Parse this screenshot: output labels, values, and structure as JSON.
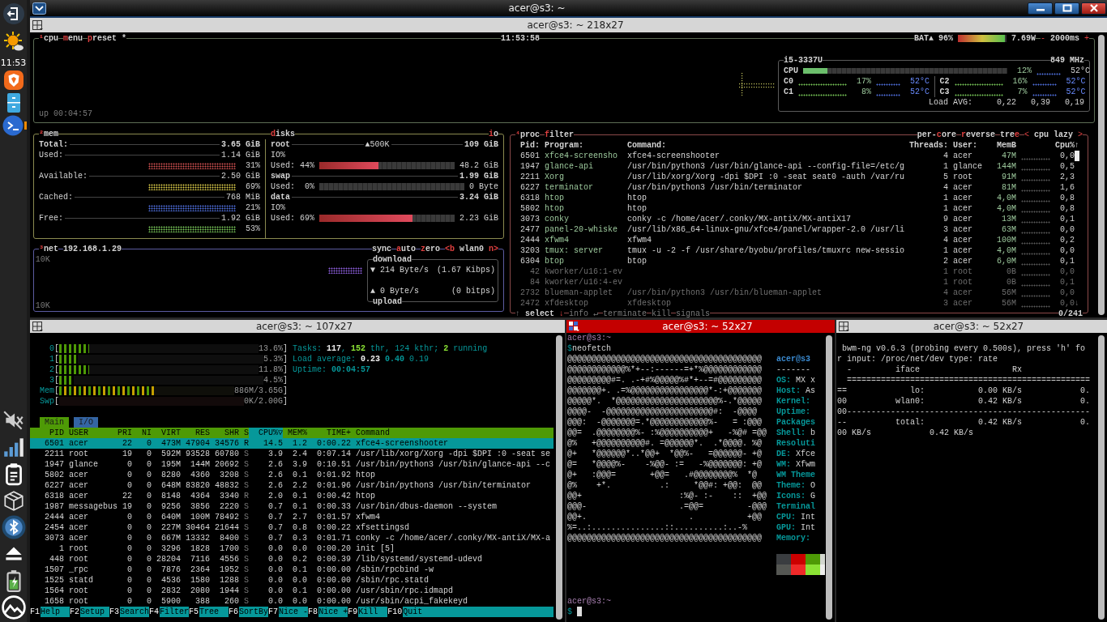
{
  "dock": {
    "clock": "11:53"
  },
  "window": {
    "title": "acer@s3: ~"
  },
  "btop_pane": {
    "title": "acer@s3: ~ 218x27",
    "active": false,
    "cpu_box": {
      "tabs": [
        {
          "parts": [
            {
              "text": "¹",
              "hotkey": true
            },
            {
              "text": "cpu",
              "hotkey": false
            }
          ]
        },
        {
          "parts": [
            {
              "text": "m",
              "hotkey": true
            },
            {
              "text": "enu",
              "hotkey": false
            }
          ]
        },
        {
          "parts": [
            {
              "text": "p",
              "hotkey": true
            },
            {
              "text": "reset *",
              "hotkey": false
            }
          ]
        }
      ],
      "clock": "11:53:58",
      "battery": {
        "label": "BAT▲",
        "percent": "96%",
        "level": 0.96,
        "power": "7.69W"
      },
      "interval": {
        "minus": "-",
        "value": "2000ms",
        "plus": "+"
      },
      "uptime": "up 00:04:57",
      "cpu_panel": {
        "model": "i5-3337U",
        "frequency": "849 MHz",
        "total": {
          "name": "CPU",
          "level": 0.12,
          "percent": "12%",
          "temperature": "52°C"
        },
        "cores": [
          {
            "name": "C0",
            "percent": "17%",
            "temperature": "52°C"
          },
          {
            "name": "C2",
            "percent": "16%",
            "temperature": "52°C"
          },
          {
            "name": "C1",
            "percent": "8%",
            "temperature": "52°C"
          },
          {
            "name": "C3",
            "percent": "7%",
            "temperature": "52°C"
          }
        ],
        "load": {
          "label": "Load AVG:",
          "values": [
            "0,22",
            "0,39",
            "0,19"
          ]
        }
      }
    },
    "mem_box": {
      "title": [
        {
          "text": "²",
          "hotkey": true
        },
        {
          "text": "mem",
          "hotkey": false
        }
      ],
      "rows": [
        {
          "label": "Total:",
          "value": "3.65 GiB",
          "bold": true
        },
        {
          "label": "Used:",
          "value": "1.14 GiB",
          "bold": false,
          "meter": {
            "kind": "used",
            "percent": "31%"
          }
        },
        {
          "label": "Available:",
          "value": "2.50 GiB",
          "bold": false,
          "meter": {
            "kind": "available",
            "percent": "69%"
          }
        },
        {
          "label": "Cached:",
          "value": "768 MiB",
          "bold": false,
          "meter": {
            "kind": "cached",
            "percent": "21%"
          }
        },
        {
          "label": "Free:",
          "value": "1.92 GiB",
          "bold": false,
          "meter": {
            "kind": "free",
            "percent": "53%"
          }
        }
      ]
    },
    "disks_box": {
      "title": [
        {
          "text": "d",
          "hotkey": true
        },
        {
          "text": "isks",
          "hotkey": false
        }
      ],
      "io_toggle": [
        {
          "text": "i",
          "hotkey": true
        },
        {
          "text": "o",
          "hotkey": false
        }
      ],
      "disks": [
        {
          "name": "root",
          "speed": "▲500K",
          "total": "109 GiB",
          "io_label": "IO%",
          "used_label": "Used:",
          "used_percent": "44%",
          "level": 0.44,
          "used": "48.2 GiB"
        },
        {
          "name": "swap",
          "total": "1.99 GiB",
          "used_label": "Used:",
          "used_percent": "0%",
          "level": 0,
          "used": "0 Byte"
        },
        {
          "name": "data",
          "total": "3.24 GiB",
          "io_label": "IO%",
          "used_label": "Used:",
          "used_percent": "69%",
          "level": 0.69,
          "used": "2.23 GiB"
        }
      ]
    },
    "net_box": {
      "title": [
        {
          "text": "³",
          "hotkey": true
        },
        {
          "text": "net",
          "hotkey": false
        }
      ],
      "address": "192.168.1.29",
      "controls": [
        {
          "parts": [
            {
              "text": "sync",
              "hotkey": false
            }
          ]
        },
        {
          "parts": [
            {
              "text": "a",
              "hotkey": true
            },
            {
              "text": "uto",
              "hotkey": false
            }
          ]
        },
        {
          "parts": [
            {
              "text": "z",
              "hotkey": true
            },
            {
              "text": "ero",
              "hotkey": false
            }
          ]
        }
      ],
      "previous": "<b",
      "interface": "wlan0",
      "next": "n>",
      "scale_top": "10K",
      "scale_bottom": "10K",
      "download": {
        "title": "download",
        "arrow": "▼",
        "rate": "214 Byte/s",
        "bits": "(1.67 Kibps)"
      },
      "upload": {
        "title": "upload",
        "arrow": "▲",
        "rate": "0 Byte/s",
        "bits": "(0 bitps)"
      }
    },
    "proc_box": {
      "title": [
        {
          "text": "⁴",
          "hotkey": true
        },
        {
          "text": "proc",
          "hotkey": false
        }
      ],
      "filter": [
        {
          "text": "f",
          "hotkey": true
        },
        {
          "text": "ilter",
          "hotkey": false
        }
      ],
      "options": [
        {
          "parts": [
            {
              "text": "per-",
              "hotkey": false
            },
            {
              "text": "c",
              "hotkey": true
            },
            {
              "text": "ore",
              "hotkey": false
            }
          ]
        },
        {
          "parts": [
            {
              "text": "r",
              "hotkey": true
            },
            {
              "text": "everse",
              "hotkey": false
            }
          ]
        },
        {
          "parts": [
            {
              "text": "tre",
              "hotkey": false
            },
            {
              "text": "e",
              "hotkey": true
            }
          ]
        }
      ],
      "sort": {
        "previous": "<",
        "value": "cpu lazy",
        "next": ">"
      },
      "columns": [
        "Pid:",
        "Program:",
        "Command:",
        "Threads:",
        "User:",
        "MemB",
        "Cpu%"
      ],
      "scroll_up": "↑",
      "scroll_down": "↓",
      "rows": [
        {
          "pid": "6501",
          "program": "xfce4-screensho",
          "command": "xfce4-screenshooter",
          "threads": "4",
          "user": "acer",
          "mem": "47M",
          "cpu": "0,0",
          "dimmed": false
        },
        {
          "pid": "1947",
          "program": "glance-api",
          "command": "/usr/bin/python3 /usr/bin/glance-api --config-file=/etc/g",
          "threads": "1",
          "user": "glance",
          "mem": "144M",
          "cpu": "0,5",
          "dimmed": false
        },
        {
          "pid": "2211",
          "program": "Xorg",
          "command": "/usr/lib/xorg/Xorg -dpi $DPI :0 -seat seat0 -auth /var/ru",
          "threads": "5",
          "user": "root",
          "mem": "91M",
          "cpu": "2,3",
          "dimmed": false
        },
        {
          "pid": "6227",
          "program": "terminator",
          "command": "/usr/bin/python3 /usr/bin/terminator",
          "threads": "4",
          "user": "acer",
          "mem": "81M",
          "cpu": "1,6",
          "dimmed": false
        },
        {
          "pid": "6318",
          "program": "htop",
          "command": "htop",
          "threads": "1",
          "user": "acer",
          "mem": "4,0M",
          "cpu": "0,8",
          "dimmed": false
        },
        {
          "pid": "5802",
          "program": "htop",
          "command": "htop",
          "threads": "1",
          "user": "acer",
          "mem": "4,0M",
          "cpu": "0,8",
          "dimmed": false
        },
        {
          "pid": "3073",
          "program": "conky",
          "command": "conky -c /home/acer/.conky/MX-antiX/MX-antiX17",
          "threads": "9",
          "user": "acer",
          "mem": "13M",
          "cpu": "0,1",
          "dimmed": false
        },
        {
          "pid": "2477",
          "program": "panel-20-whiske",
          "command": "/usr/lib/x86_64-linux-gnu/xfce4/panel/wrapper-2.0 /usr/li",
          "threads": "3",
          "user": "acer",
          "mem": "63M",
          "cpu": "0,0",
          "dimmed": false
        },
        {
          "pid": "2444",
          "program": "xfwm4",
          "command": "xfwm4",
          "threads": "4",
          "user": "acer",
          "mem": "100M",
          "cpu": "0,2",
          "dimmed": false
        },
        {
          "pid": "3203",
          "program": "tmux: server",
          "command": "tmux -u -2 -f /usr/share/byobu/profiles/tmuxrc new-sessio",
          "threads": "1",
          "user": "acer",
          "mem": "4,0M",
          "cpu": "0,0",
          "dimmed": false
        },
        {
          "pid": "6304",
          "program": "btop",
          "command": "btop",
          "threads": "2",
          "user": "acer",
          "mem": "6,0M",
          "cpu": "0,1",
          "dimmed": false
        },
        {
          "pid": "42",
          "program": "kworker/u16:1-ev",
          "threads": "1",
          "user": "root",
          "mem": "0B",
          "cpu": "0,0",
          "dimmed": true
        },
        {
          "pid": "84",
          "program": "kworker/u16:4-ev",
          "threads": "1",
          "user": "root",
          "mem": "0B",
          "cpu": "0,1",
          "dimmed": true
        },
        {
          "pid": "2732",
          "program": "blueman-applet",
          "command": "/usr/bin/python3 /usr/bin/blueman-applet",
          "threads": "4",
          "user": "acer",
          "mem": "56M",
          "cpu": "0,0",
          "dimmed": true
        },
        {
          "pid": "2472",
          "program": "xfdesktop",
          "command": "xfdesktop",
          "threads": "3",
          "user": "acer",
          "mem": "56M",
          "cpu": "0,0",
          "dimmed": true
        }
      ],
      "footer": {
        "select": {
          "up": "↑",
          "label": "select",
          "down": "↓"
        },
        "actions": [
          {
            "label": "info",
            "symbol": "↵",
            "disabled": true
          },
          {
            "label": "terminate",
            "disabled": true
          },
          {
            "label": "kill",
            "disabled": true
          },
          {
            "label": "signals",
            "disabled": true
          }
        ],
        "count": "0/241"
      }
    }
  },
  "htop_pane": {
    "title": "acer@s3: ~ 107x27",
    "active": false,
    "meters": [
      {
        "label": "0",
        "kind": "cpu",
        "open": "[",
        "level": 0.15,
        "reading": "13.6%",
        "close": "]"
      },
      {
        "label": "1",
        "kind": "cpu",
        "open": "[",
        "level": 0.09,
        "reading": "5.3%",
        "close": "]"
      },
      {
        "label": "2",
        "kind": "cpu",
        "open": "[",
        "level": 0.15,
        "reading": "11.8%",
        "close": "]"
      },
      {
        "label": "3",
        "kind": "cpu",
        "open": "[",
        "level": 0.07,
        "reading": "4.5%",
        "close": "]"
      },
      {
        "label": "Mem",
        "kind": "memory",
        "open": "[",
        "level": 0.54,
        "reading": "886M/3.65G",
        "close": "]"
      },
      {
        "label": "Swp",
        "kind": "swap",
        "open": "[",
        "level": 0,
        "reading": "0K/2.00G",
        "close": "]"
      }
    ],
    "info": [
      [
        {
          "text": "Tasks: ",
          "kind": "label"
        },
        {
          "text": "117",
          "kind": "value"
        },
        {
          "text": ", ",
          "kind": "label"
        },
        {
          "text": "152",
          "kind": "accent"
        },
        {
          "text": " thr, ",
          "kind": "label"
        },
        {
          "text": "124",
          "kind": "label"
        },
        {
          "text": " kthr; ",
          "kind": "label"
        },
        {
          "text": "2",
          "kind": "accent"
        },
        {
          "text": " running",
          "kind": "label"
        }
      ],
      [
        {
          "text": "Load average: ",
          "kind": "label"
        },
        {
          "text": "0.23",
          "kind": "value"
        },
        {
          "text": " 0.40",
          "kind": "strong"
        },
        {
          "text": " 0.19",
          "kind": "label"
        }
      ],
      [
        {
          "text": "Uptime: ",
          "kind": "label"
        },
        {
          "text": "00:04:57",
          "kind": "strong"
        }
      ]
    ],
    "tabs": [
      {
        "label": "Main",
        "selected": true
      },
      {
        "label": "I/O",
        "selected": false
      }
    ],
    "columns": [
      {
        "label": "PID",
        "sorted": false
      },
      {
        "label": "USER",
        "sorted": false
      },
      {
        "label": "PRI",
        "sorted": false
      },
      {
        "label": "NI",
        "sorted": false
      },
      {
        "label": "VIRT",
        "sorted": false
      },
      {
        "label": "RES",
        "sorted": false
      },
      {
        "label": "SHR",
        "sorted": false
      },
      {
        "label": "S",
        "sorted": false
      },
      {
        "label": "CPU%▽",
        "sorted": true
      },
      {
        "label": "MEM%",
        "sorted": false
      },
      {
        "label": "TIME+",
        "sorted": false
      },
      {
        "label": "Command",
        "sorted": false
      }
    ],
    "rows": [
      {
        "pid": "6501",
        "user": "acer",
        "pri": "22",
        "ni": "0",
        "virt": "473M",
        "res": "47904",
        "shr": "34576",
        "state": "R",
        "cpu": "14.5",
        "mem": "1.2",
        "time": "0:00.22",
        "command": "xfce4-screenshooter",
        "selected": true
      },
      {
        "pid": "2211",
        "user": "root",
        "pri": "19",
        "ni": "0",
        "virt": "592M",
        "res": "93528",
        "shr": "60780",
        "state": "S",
        "cpu": "3.9",
        "mem": "2.4",
        "time": "0:07.14",
        "command": "/usr/lib/xorg/Xorg -dpi $DPI :0 -seat se",
        "selected": false
      },
      {
        "pid": "1947",
        "user": "glance",
        "pri": "0",
        "ni": "0",
        "virt": "195M",
        "res": "144M",
        "shr": "20692",
        "state": "S",
        "cpu": "2.6",
        "mem": "3.9",
        "time": "0:10.51",
        "command": "/usr/bin/python3 /usr/bin/glance-api --c",
        "selected": false
      },
      {
        "pid": "5802",
        "user": "acer",
        "pri": "0",
        "ni": "0",
        "virt": "8280",
        "res": "4360",
        "shr": "3208",
        "state": "S",
        "cpu": "2.6",
        "mem": "0.1",
        "time": "0:01.92",
        "command": "htop",
        "selected": false
      },
      {
        "pid": "6227",
        "user": "acer",
        "pri": "0",
        "ni": "0",
        "virt": "648M",
        "res": "83820",
        "shr": "48832",
        "state": "S",
        "cpu": "2.6",
        "mem": "2.2",
        "time": "0:01.96",
        "command": "/usr/bin/python3 /usr/bin/terminator",
        "selected": false
      },
      {
        "pid": "6318",
        "user": "acer",
        "pri": "22",
        "ni": "0",
        "virt": "8148",
        "res": "4364",
        "shr": "3340",
        "state": "R",
        "cpu": "2.0",
        "mem": "0.1",
        "time": "0:00.42",
        "command": "htop",
        "selected": false
      },
      {
        "pid": "1987",
        "user": "messagebus",
        "pri": "19",
        "ni": "0",
        "virt": "9256",
        "res": "3856",
        "shr": "2220",
        "state": "S",
        "cpu": "0.7",
        "mem": "0.1",
        "time": "0:00.33",
        "command": "/usr/bin/dbus-daemon --system",
        "selected": false
      },
      {
        "pid": "2444",
        "user": "acer",
        "pri": "0",
        "ni": "0",
        "virt": "640M",
        "res": "100M",
        "shr": "78492",
        "state": "S",
        "cpu": "0.7",
        "mem": "2.7",
        "time": "0:01.57",
        "command": "xfwm4",
        "selected": false
      },
      {
        "pid": "2454",
        "user": "acer",
        "pri": "0",
        "ni": "0",
        "virt": "227M",
        "res": "30464",
        "shr": "21644",
        "state": "S",
        "cpu": "0.7",
        "mem": "0.8",
        "time": "0:00.22",
        "command": "xfsettingsd",
        "selected": false
      },
      {
        "pid": "3073",
        "user": "acer",
        "pri": "0",
        "ni": "0",
        "virt": "667M",
        "res": "13332",
        "shr": "8400",
        "state": "S",
        "cpu": "0.7",
        "mem": "0.3",
        "time": "0:01.71",
        "command": "conky -c /home/acer/.conky/MX-antiX/MX-a",
        "selected": false
      },
      {
        "pid": "1",
        "user": "root",
        "pri": "0",
        "ni": "0",
        "virt": "3296",
        "res": "1828",
        "shr": "1700",
        "state": "S",
        "cpu": "0.0",
        "mem": "0.0",
        "time": "0:00.20",
        "command": "init [5]",
        "selected": false
      },
      {
        "pid": "448",
        "user": "root",
        "pri": "0",
        "ni": "0",
        "virt": "28204",
        "res": "7116",
        "shr": "4556",
        "state": "S",
        "cpu": "0.0",
        "mem": "0.2",
        "time": "0:00.39",
        "command": "/lib/systemd/systemd-udevd",
        "selected": false
      },
      {
        "pid": "1507",
        "user": "_rpc",
        "pri": "0",
        "ni": "0",
        "virt": "7876",
        "res": "2364",
        "shr": "1952",
        "state": "S",
        "cpu": "0.0",
        "mem": "0.1",
        "time": "0:00.00",
        "command": "/sbin/rpcbind -w",
        "selected": false
      },
      {
        "pid": "1525",
        "user": "statd",
        "pri": "0",
        "ni": "0",
        "virt": "4536",
        "res": "1580",
        "shr": "1288",
        "state": "S",
        "cpu": "0.0",
        "mem": "0.0",
        "time": "0:00.00",
        "command": "/sbin/rpc.statd",
        "selected": false
      },
      {
        "pid": "1564",
        "user": "root",
        "pri": "0",
        "ni": "0",
        "virt": "2832",
        "res": "2080",
        "shr": "1944",
        "state": "S",
        "cpu": "0.0",
        "mem": "0.1",
        "time": "0:00.00",
        "command": "/usr/sbin/rpc.idmapd",
        "selected": false
      },
      {
        "pid": "1658",
        "user": "root",
        "pri": "0",
        "ni": "0",
        "virt": "5900",
        "res": "388",
        "shr": "260",
        "state": "S",
        "cpu": "0.0",
        "mem": "0.0",
        "time": "0:00.00",
        "command": "/usr/sbin/acpi_fakekeyd",
        "selected": false
      }
    ],
    "keys": [
      {
        "key": "F1",
        "label": "Help"
      },
      {
        "key": "F2",
        "label": "Setup"
      },
      {
        "key": "F3",
        "label": "Search"
      },
      {
        "key": "F4",
        "label": "Filter"
      },
      {
        "key": "F5",
        "label": "Tree"
      },
      {
        "key": "F6",
        "label": "SortBy"
      },
      {
        "key": "F7",
        "label": "Nice -"
      },
      {
        "key": "F8",
        "label": "Nice +"
      },
      {
        "key": "F9",
        "label": "Kill"
      },
      {
        "key": "F10",
        "label": "Quit"
      }
    ]
  },
  "neofetch_pane": {
    "title": "acer@s3: ~ 52x27",
    "active": true,
    "prompt": "acer@s3:~",
    "command": {
      "symbol": "$",
      "text": "neofetch"
    },
    "art": [
      "@@@@@@@@@@@@@@@@@@@@@@@@@@@@@@@@@@@@@@@@",
      "@@@@@@@@@@@@%*+--:------=+*%@@@@@@@@@@@@",
      "@@@@@@@@@#=. .-+#%@@@@@%#*+--=#@@@@@@@@@",
      "@@@@@@@+. .=%@@@@@@@@@@@@@@@@*-:+@@@@@@@",
      "@@@@@*.  *@@@@@@@@@@@@@@@@@@@@@%-.*@@@@@",
      "@@@@-  -@@@@@@@@@@@@@@@@@@@@@@#:  -@@@@",
      "@@@:  -@@@@@@@=.*@@@@@@@@@@@@%-   = :@@@",
      "@@=  .@@@@@@@@%- :%@@@@@@@@@@+   -%@# =@@",
      "@%   +@@@@@@@@@@#. =@@@@@@*.  .*@@@@. %@",
      "@+   *@@@@@@*..*@@+  *@@%-   =@@@@@@- +@",
      "@=   *@@@@%-    -%@@- :=   -%@@@@@@@: +@",
      "@+   :@@@=       +@@=   .#@@@@@@@@%  *@",
      "@%    +*.          .:     *@@#: +@@:  @@",
      "@@+                    :%@- :-    ::  +@@",
      "@@@-                   .=@@=         -@@@",
      "@@+.                     .           +@@",
      "%=..:...............::..........:..-%",
      "@@@@@@@@@@@@@@@@@@@@@@@@@@@@@@@@@@@@@@@@"
    ],
    "info": [
      {
        "kind": "title",
        "label": "acer@s3"
      },
      {
        "kind": "rule",
        "label": "-------"
      },
      {
        "kind": "field",
        "label": "OS:",
        "value": "MX x"
      },
      {
        "kind": "field",
        "label": "Host:",
        "value": "As"
      },
      {
        "kind": "field",
        "label": "Kernel:"
      },
      {
        "kind": "field",
        "label": "Uptime:"
      },
      {
        "kind": "field",
        "label": "Packages"
      },
      {
        "kind": "field",
        "label": "Shell:",
        "value": "b"
      },
      {
        "kind": "field",
        "label": "Resoluti"
      },
      {
        "kind": "field",
        "label": "DE:",
        "value": "Xfce"
      },
      {
        "kind": "field",
        "label": "WM:",
        "value": "Xfwm"
      },
      {
        "kind": "field",
        "label": "WM Theme"
      },
      {
        "kind": "field",
        "label": "Theme:",
        "value": "O"
      },
      {
        "kind": "field",
        "label": "Icons:",
        "value": "G"
      },
      {
        "kind": "field",
        "label": "Terminal"
      },
      {
        "kind": "field",
        "label": "CPU:",
        "value": "Int"
      },
      {
        "kind": "field",
        "label": "GPU:",
        "value": "Int"
      },
      {
        "kind": "field",
        "label": "Memory:"
      }
    ],
    "palette": [
      {
        "colors": [
          {
            "color": "#3a3d40"
          },
          {
            "color": "#cc0000"
          },
          {
            "color": "#4e9a06"
          },
          {
            "color": "#d3d7cf"
          }
        ]
      },
      {
        "colors": [
          {
            "color": "#555753"
          },
          {
            "color": "#ef2929"
          },
          {
            "color": "#8ae234"
          },
          {
            "color": "#eeeeec"
          }
        ]
      }
    ],
    "final_prompt": "acer@s3:~",
    "final_symbol": "$"
  },
  "bwm_pane": {
    "title": "acer@s3: ~ 52x27",
    "active": false,
    "lines": [
      " bwm-ng v0.6.3 (probing every 0.500s), press 'h' fo",
      "r input: /proc/net/dev type: rate",
      "  -         iface                   Rx",
      "  ==================================================",
      "==             lo:           0.00 KB/s            0.",
      "00          wlan0:           0.42 KB/s            0.",
      "00--------------------------------------------------",
      "--          total:           0.42 KB/s            0.",
      "00 KB/s            0.42 KB/s"
    ]
  }
}
